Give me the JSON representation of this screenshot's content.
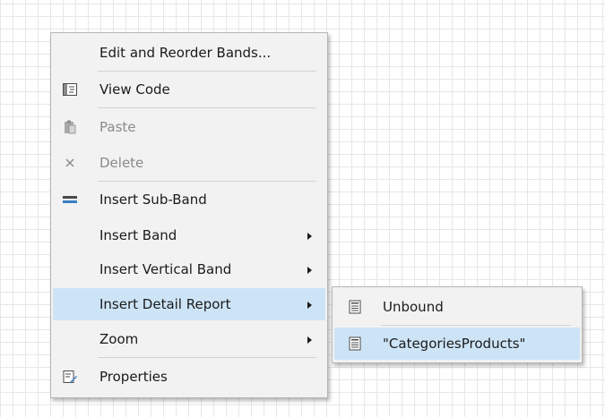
{
  "context_menu": {
    "items": [
      {
        "label": "Edit and Reorder Bands..."
      },
      {
        "label": "View Code"
      },
      {
        "label": "Paste"
      },
      {
        "label": "Delete"
      },
      {
        "label": "Insert Sub-Band"
      },
      {
        "label": "Insert Band"
      },
      {
        "label": "Insert Vertical Band"
      },
      {
        "label": "Insert Detail Report"
      },
      {
        "label": "Zoom"
      },
      {
        "label": "Properties"
      }
    ]
  },
  "submenu": {
    "items": [
      {
        "label": "Unbound"
      },
      {
        "label": "\"CategoriesProducts\""
      }
    ]
  },
  "colors": {
    "highlight": "#cde4f7",
    "menu_background": "#f2f2f2",
    "grid_line": "#e7e7e7",
    "sub_band_icon": "#3a7ec2"
  },
  "icons": {
    "view_code": "code-view-icon",
    "paste": "clipboard-paste-icon",
    "delete": "delete-x-icon",
    "insert_sub_band": "sub-band-icon",
    "properties": "properties-icon",
    "report": "report-document-icon"
  }
}
